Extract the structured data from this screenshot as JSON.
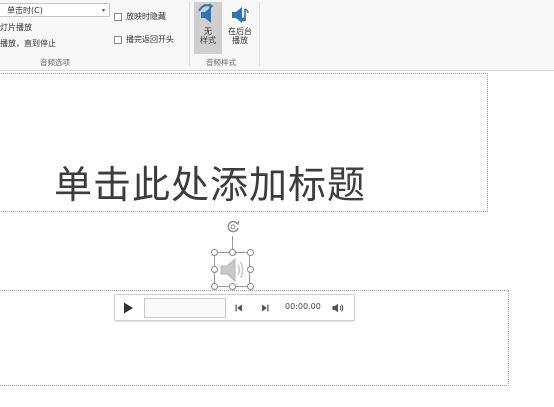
{
  "ribbon": {
    "audio_options": {
      "start_value": "单击时(C)",
      "play_across_slides": "灯片播放",
      "loop_until_stopped": "播放，直到停止",
      "hide_during_show": "放映时隐藏",
      "rewind_after_playing": "播完返回开头",
      "group_label": "音频选项"
    },
    "audio_styles": {
      "no_style_label": "无\n样式",
      "play_in_background_label": "在后台\n播放",
      "group_label": "音频样式"
    }
  },
  "slide": {
    "title_placeholder": "单击此处添加标题"
  },
  "player": {
    "time": "00:00.00"
  },
  "colors": {
    "selected_button_bg": "#cfcfcf",
    "icon_blue": "#2e75b6",
    "placeholder_border": "#9a9a9a"
  },
  "icons": [
    "dropdown-arrow-icon",
    "no-style-speaker-icon",
    "background-play-speaker-icon",
    "rotate-icon",
    "speaker-icon",
    "play-icon",
    "previous-icon",
    "next-icon",
    "volume-icon"
  ]
}
